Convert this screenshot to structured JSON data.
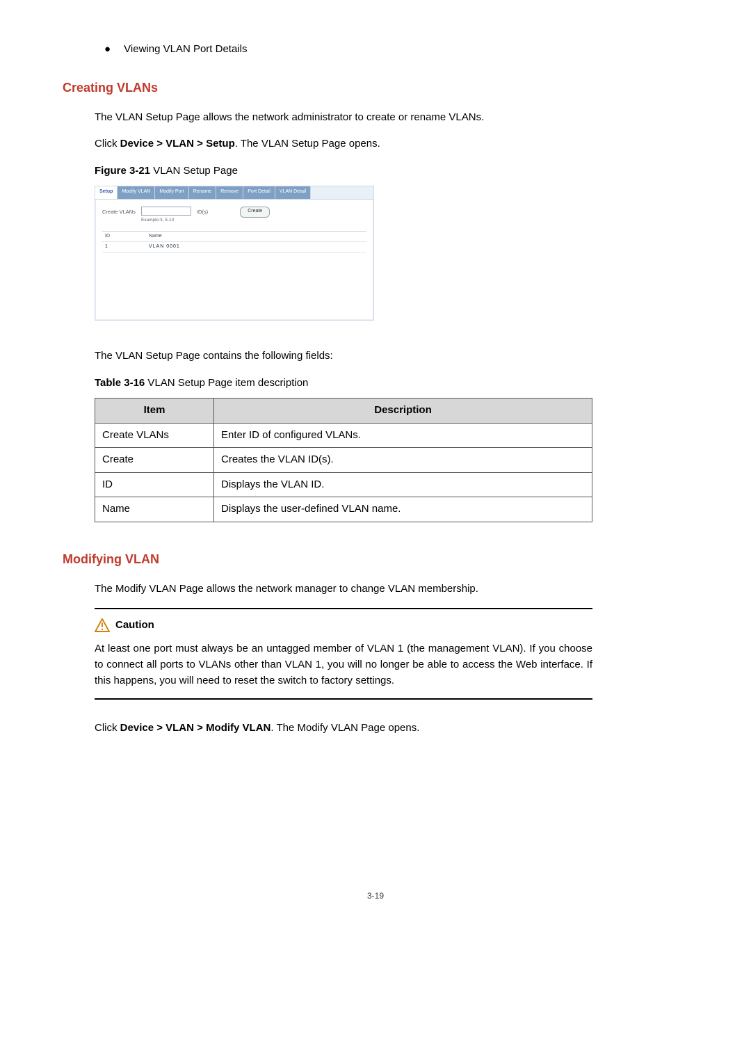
{
  "bullet": {
    "text": "Viewing VLAN Port Details"
  },
  "section1": {
    "heading": "Creating VLANs",
    "p1": "The VLAN Setup Page allows the network administrator to create or rename VLANs.",
    "p2_pre": "Click ",
    "p2_bold": "Device > VLAN > Setup",
    "p2_post": ". The VLAN Setup Page opens.",
    "fig_label_bold": "Figure 3-21",
    "fig_label_rest": " VLAN Setup Page"
  },
  "figure": {
    "tabs": [
      "Setup",
      "Modify VLAN",
      "Modify Port",
      "Rename",
      "Remove",
      "Port Detail",
      "VLAN Detail"
    ],
    "active_tab_index": 0,
    "form_label": "Create VLANs",
    "example": "Example:3, 5-10",
    "ids_label": "ID(s)",
    "create_btn": "Create",
    "col_id": "ID",
    "col_name": "Name",
    "row_id": "1",
    "row_name": "VLAN 0001"
  },
  "after_fig_p": "The VLAN Setup Page contains the following fields:",
  "table_caption_bold": "Table 3-16",
  "table_caption_rest": " VLAN Setup Page item description",
  "table": {
    "head_item": "Item",
    "head_desc": "Description",
    "rows": [
      {
        "item": "Create VLANs",
        "desc": "Enter ID of configured VLANs."
      },
      {
        "item": "Create",
        "desc": "Creates the VLAN ID(s)."
      },
      {
        "item": "ID",
        "desc": "Displays the VLAN ID."
      },
      {
        "item": "Name",
        "desc": "Displays the user-defined VLAN name."
      }
    ]
  },
  "section2": {
    "heading": "Modifying VLAN",
    "p1": "The Modify VLAN Page allows the network manager to change VLAN membership.",
    "caution_label": "Caution",
    "caution_body": "At least one port must always be an untagged member of VLAN 1 (the management VLAN). If you choose to connect all ports to VLANs other than VLAN 1, you will no longer be able to access the Web interface. If this happens, you will need to reset the switch to factory settings.",
    "p2_pre": "Click ",
    "p2_bold": "Device > VLAN > Modify VLAN",
    "p2_post": ". The Modify VLAN Page opens."
  },
  "page_number": "3-19"
}
